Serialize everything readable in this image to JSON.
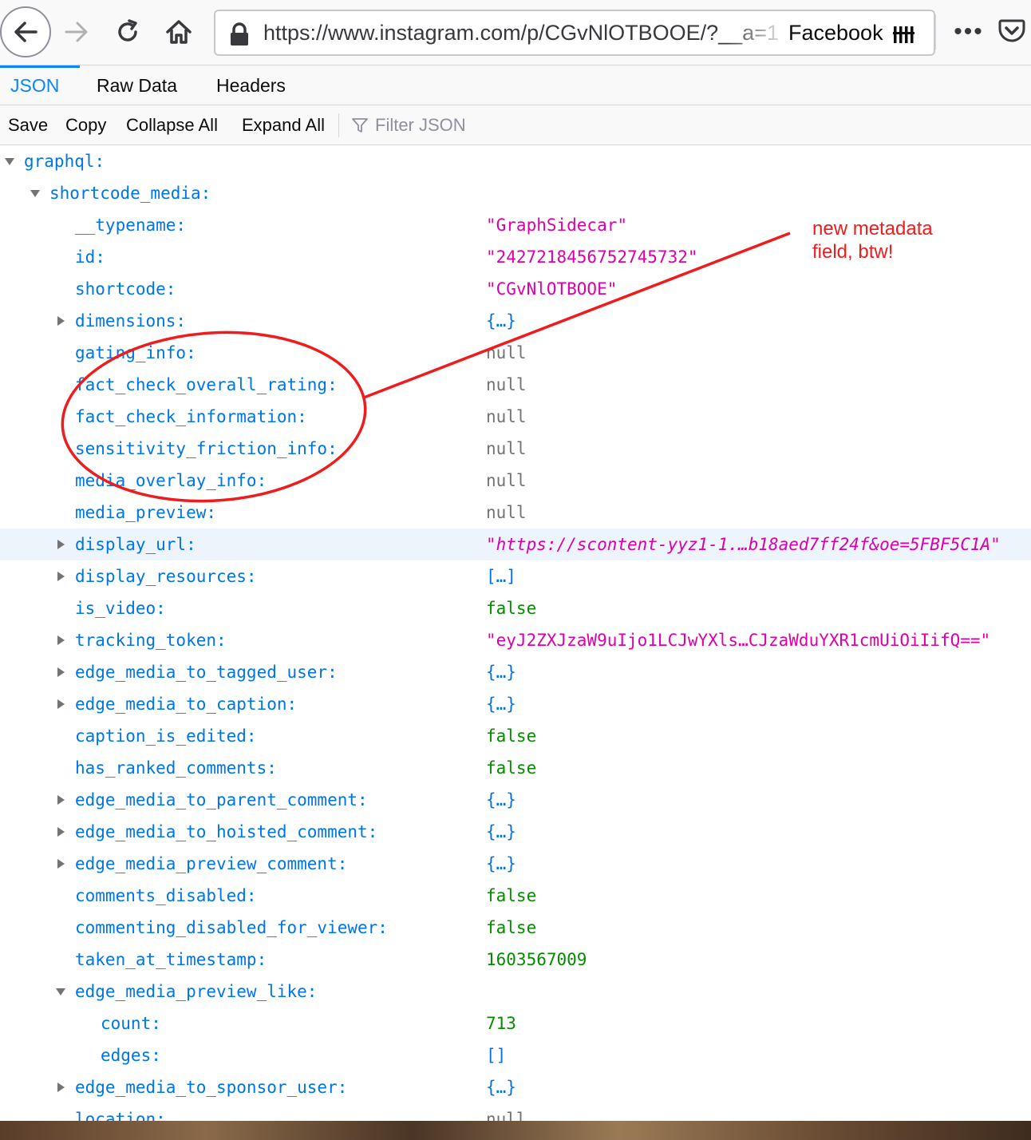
{
  "browser": {
    "url": "https://www.instagram.com/p/CGvNlOTBOOE/?__a=1",
    "bookmark_label": "Facebook",
    "more_label": "•••"
  },
  "viewer": {
    "tabs": [
      {
        "label": "JSON",
        "active": true
      },
      {
        "label": "Raw Data",
        "active": false
      },
      {
        "label": "Headers",
        "active": false
      }
    ],
    "actions": {
      "save": "Save",
      "copy": "Copy",
      "collapse_all": "Collapse All",
      "expand_all": "Expand All",
      "filter_placeholder": "Filter JSON"
    }
  },
  "tree": [
    {
      "key": "graphql:",
      "value": "",
      "vtype": "none",
      "level": 0,
      "twisty": "open",
      "highlight": false
    },
    {
      "key": "shortcode_media:",
      "value": "",
      "vtype": "none",
      "level": 1,
      "twisty": "open",
      "highlight": false
    },
    {
      "key": "__typename:",
      "value": "\"GraphSidecar\"",
      "vtype": "string",
      "level": 2,
      "twisty": "none",
      "highlight": false
    },
    {
      "key": "id:",
      "value": "\"2427218456752745732\"",
      "vtype": "string",
      "level": 2,
      "twisty": "none",
      "highlight": false
    },
    {
      "key": "shortcode:",
      "value": "\"CGvNlOTBOOE\"",
      "vtype": "string",
      "level": 2,
      "twisty": "none",
      "highlight": false
    },
    {
      "key": "dimensions:",
      "value": "{…}",
      "vtype": "obj",
      "level": 2,
      "twisty": "closed",
      "highlight": false
    },
    {
      "key": "gating_info:",
      "value": "null",
      "vtype": "null",
      "level": 2,
      "twisty": "none",
      "highlight": false
    },
    {
      "key": "fact_check_overall_rating:",
      "value": "null",
      "vtype": "null",
      "level": 2,
      "twisty": "none",
      "highlight": false
    },
    {
      "key": "fact_check_information:",
      "value": "null",
      "vtype": "null",
      "level": 2,
      "twisty": "none",
      "highlight": false
    },
    {
      "key": "sensitivity_friction_info:",
      "value": "null",
      "vtype": "null",
      "level": 2,
      "twisty": "none",
      "highlight": false
    },
    {
      "key": "media_overlay_info:",
      "value": "null",
      "vtype": "null",
      "level": 2,
      "twisty": "none",
      "highlight": false
    },
    {
      "key": "media_preview:",
      "value": "null",
      "vtype": "null",
      "level": 2,
      "twisty": "none",
      "highlight": false
    },
    {
      "key": "display_url:",
      "value": "\"https://scontent-yyz1-1.…b18aed7ff24f&oe=5FBF5C1A\"",
      "vtype": "url",
      "level": 2,
      "twisty": "closed",
      "highlight": true
    },
    {
      "key": "display_resources:",
      "value": "[…]",
      "vtype": "obj",
      "level": 2,
      "twisty": "closed",
      "highlight": false
    },
    {
      "key": "is_video:",
      "value": "false",
      "vtype": "bool",
      "level": 2,
      "twisty": "none",
      "highlight": false
    },
    {
      "key": "tracking_token:",
      "value": "\"eyJ2ZXJzaW9uIjo1LCJwYXls…CJzaWduYXR1cmUiOiIifQ==\"",
      "vtype": "string",
      "level": 2,
      "twisty": "closed",
      "highlight": false
    },
    {
      "key": "edge_media_to_tagged_user:",
      "value": "{…}",
      "vtype": "obj",
      "level": 2,
      "twisty": "closed",
      "highlight": false
    },
    {
      "key": "edge_media_to_caption:",
      "value": "{…}",
      "vtype": "obj",
      "level": 2,
      "twisty": "closed",
      "highlight": false
    },
    {
      "key": "caption_is_edited:",
      "value": "false",
      "vtype": "bool",
      "level": 2,
      "twisty": "none",
      "highlight": false
    },
    {
      "key": "has_ranked_comments:",
      "value": "false",
      "vtype": "bool",
      "level": 2,
      "twisty": "none",
      "highlight": false
    },
    {
      "key": "edge_media_to_parent_comment:",
      "value": "{…}",
      "vtype": "obj",
      "level": 2,
      "twisty": "closed",
      "highlight": false
    },
    {
      "key": "edge_media_to_hoisted_comment:",
      "value": "{…}",
      "vtype": "obj",
      "level": 2,
      "twisty": "closed",
      "highlight": false
    },
    {
      "key": "edge_media_preview_comment:",
      "value": "{…}",
      "vtype": "obj",
      "level": 2,
      "twisty": "closed",
      "highlight": false
    },
    {
      "key": "comments_disabled:",
      "value": "false",
      "vtype": "bool",
      "level": 2,
      "twisty": "none",
      "highlight": false
    },
    {
      "key": "commenting_disabled_for_viewer:",
      "value": "false",
      "vtype": "bool",
      "level": 2,
      "twisty": "none",
      "highlight": false
    },
    {
      "key": "taken_at_timestamp:",
      "value": "1603567009",
      "vtype": "num",
      "level": 2,
      "twisty": "none",
      "highlight": false
    },
    {
      "key": "edge_media_preview_like:",
      "value": "",
      "vtype": "none",
      "level": 2,
      "twisty": "open",
      "highlight": false
    },
    {
      "key": "count:",
      "value": "713",
      "vtype": "num",
      "level": 3,
      "twisty": "none",
      "highlight": false
    },
    {
      "key": "edges:",
      "value": "[]",
      "vtype": "obj",
      "level": 3,
      "twisty": "none",
      "highlight": false
    },
    {
      "key": "edge_media_to_sponsor_user:",
      "value": "{…}",
      "vtype": "obj",
      "level": 2,
      "twisty": "closed",
      "highlight": false
    },
    {
      "key": "location:",
      "value": "null",
      "vtype": "null",
      "level": 2,
      "twisty": "none",
      "highlight": false
    }
  ],
  "annotation": {
    "note": "new metadata field, btw!",
    "color": "#ee1c1c"
  },
  "colors": {
    "accent": "#0a84ff",
    "key": "#0074e8",
    "string": "#dd00a9",
    "bool_num": "#058b00",
    "null": "#737373"
  }
}
